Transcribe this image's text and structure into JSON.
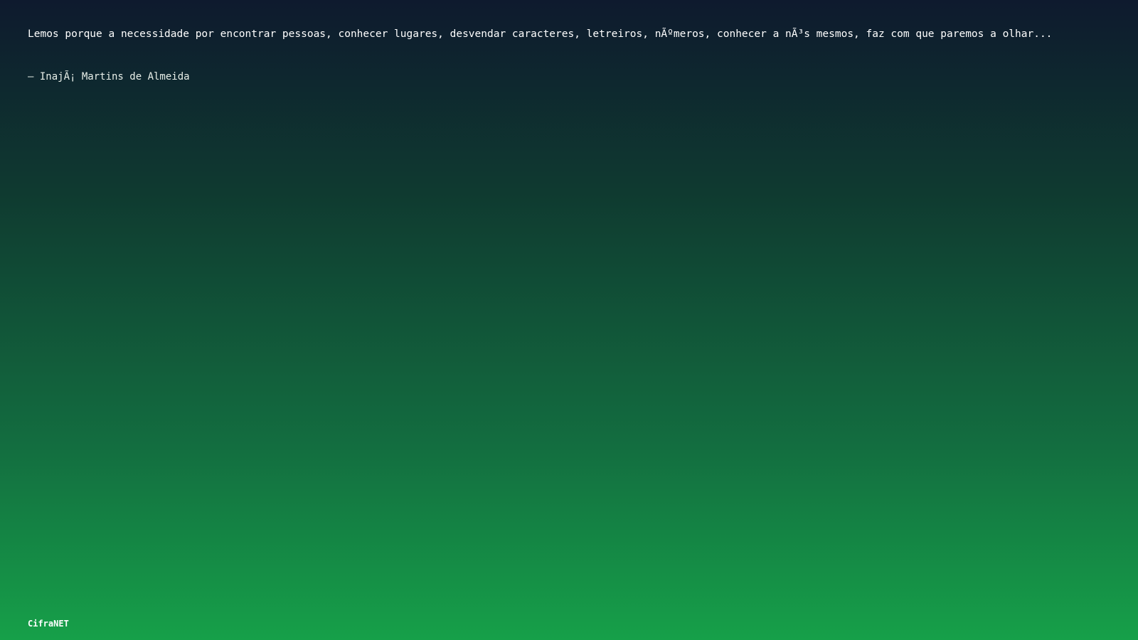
{
  "quote": {
    "text": "Lemos porque a necessidade por encontrar pessoas, conhecer lugares, desvendar caracteres, letreiros, nÃºmeros, conhecer a nÃ³s mesmos, faz com que paremos a olhar...",
    "author": "– InajÃ¡ Martins de Almeida"
  },
  "brand": {
    "name": "CifraNET"
  },
  "colors": {
    "gradient_top": "#0e1a2e",
    "gradient_bottom": "#16a049",
    "text": "#ffffff"
  }
}
